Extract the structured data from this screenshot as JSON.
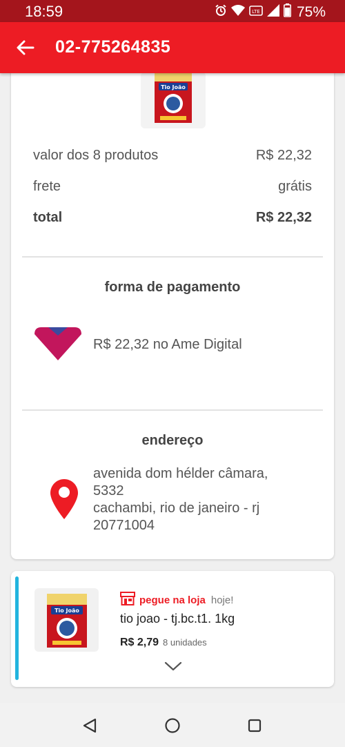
{
  "status_bar": {
    "time": "18:59",
    "battery": "75%",
    "icons": [
      "alarm-icon",
      "wifi-icon",
      "volte-icon",
      "signal-icon",
      "battery-icon"
    ]
  },
  "header": {
    "title": "02-775264835",
    "back_icon": "arrow-left-icon",
    "background": "#ed1c24"
  },
  "summary": {
    "products_label": "valor dos 8 produtos",
    "products_value": "R$ 22,32",
    "shipping_label": "frete",
    "shipping_value": "grátis",
    "total_label": "total",
    "total_value": "R$ 22,32"
  },
  "payment": {
    "title": "forma de pagamento",
    "method_icon": "ame-digital-logo",
    "description": "R$ 22,32 no Ame Digital"
  },
  "address": {
    "title": "endereço",
    "icon": "location-pin-icon",
    "line1": "avenida dom hélder câmara,",
    "line2": "5332",
    "line3": "cachambi, rio de janeiro - rj",
    "line4": "20771004"
  },
  "item": {
    "pickup_icon": "store-icon",
    "pickup_label": "pegue na loja",
    "pickup_when": "hoje!",
    "name": "tio joao - tj.bc.t1. 1kg",
    "price": "R$ 2,79",
    "quantity": "8 unidades",
    "expand_icon": "chevron-down-icon",
    "product_brand": "Tio João",
    "accent_color": "#22b4de"
  },
  "nav": {
    "back": "triangle-back-icon",
    "home": "circle-home-icon",
    "recents": "square-recents-icon"
  }
}
